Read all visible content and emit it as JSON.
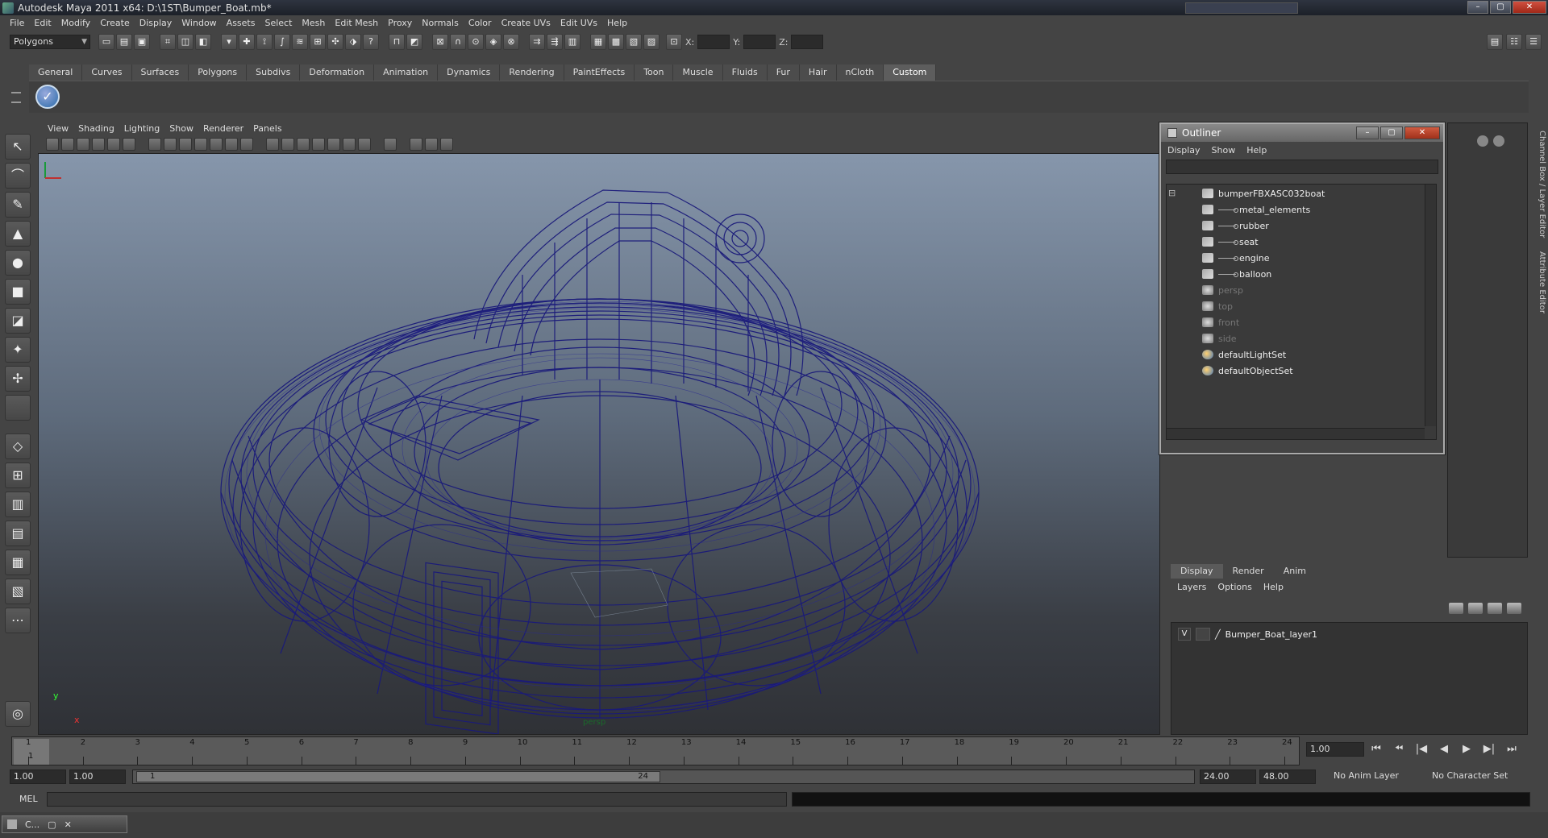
{
  "window": {
    "title": "Autodesk Maya 2011 x64: D:\\1ST\\Bumper_Boat.mb*",
    "min": "–",
    "max": "▢",
    "close": "✕"
  },
  "menubar": [
    "File",
    "Edit",
    "Modify",
    "Create",
    "Display",
    "Window",
    "Assets",
    "Select",
    "Mesh",
    "Edit Mesh",
    "Proxy",
    "Normals",
    "Color",
    "Create UVs",
    "Edit UVs",
    "Help"
  ],
  "statusline": {
    "mode": "Polygons",
    "x_label": "X:",
    "y_label": "Y:",
    "z_label": "Z:"
  },
  "shelf_tabs": [
    "General",
    "Curves",
    "Surfaces",
    "Polygons",
    "Subdivs",
    "Deformation",
    "Animation",
    "Dynamics",
    "Rendering",
    "PaintEffects",
    "Toon",
    "Muscle",
    "Fluids",
    "Fur",
    "Hair",
    "nCloth",
    "Custom"
  ],
  "shelf_active": "Custom",
  "viewport": {
    "menu": [
      "View",
      "Shading",
      "Lighting",
      "Show",
      "Renderer",
      "Panels"
    ],
    "camera": "persp",
    "axis_y": "y",
    "axis_x": "x"
  },
  "outliner": {
    "title": "Outliner",
    "menu": [
      "Display",
      "Show",
      "Help"
    ],
    "collapse": "⊟",
    "items": [
      {
        "label": "bumperFBXASC032boat",
        "style": "lit",
        "icon": "transform-icon",
        "indent": 0
      },
      {
        "label": "metal_elements",
        "style": "lit",
        "icon": "mesh-icon",
        "indent": 1
      },
      {
        "label": "rubber",
        "style": "lit",
        "icon": "mesh-icon",
        "indent": 1
      },
      {
        "label": "seat",
        "style": "lit",
        "icon": "mesh-icon",
        "indent": 1
      },
      {
        "label": "engine",
        "style": "lit",
        "icon": "mesh-icon",
        "indent": 1
      },
      {
        "label": "balloon",
        "style": "lit",
        "icon": "mesh-icon",
        "indent": 1
      },
      {
        "label": "persp",
        "style": "dim",
        "icon": "camera-icon",
        "indent": 0
      },
      {
        "label": "top",
        "style": "dim",
        "icon": "camera-icon",
        "indent": 0
      },
      {
        "label": "front",
        "style": "dim",
        "icon": "camera-icon",
        "indent": 0
      },
      {
        "label": "side",
        "style": "dim",
        "icon": "camera-icon",
        "indent": 0
      },
      {
        "label": "defaultLightSet",
        "style": "lit",
        "icon": "set-icon",
        "indent": 0
      },
      {
        "label": "defaultObjectSet",
        "style": "lit",
        "icon": "set-icon",
        "indent": 0
      }
    ]
  },
  "right_tabs": [
    "Channel Box / Layer Editor",
    "Attribute Editor"
  ],
  "layers": {
    "tabs": [
      "Display",
      "Render",
      "Anim"
    ],
    "menu": [
      "Layers",
      "Options",
      "Help"
    ],
    "layer_visible": "V",
    "layer_name": "Bumper_Boat_layer1"
  },
  "timeline": {
    "ticks": [
      "1",
      "2",
      "3",
      "4",
      "5",
      "6",
      "7",
      "8",
      "9",
      "10",
      "11",
      "12",
      "13",
      "14",
      "15",
      "16",
      "17",
      "18",
      "19",
      "20",
      "21",
      "22",
      "23",
      "24"
    ],
    "current_marker": "1",
    "current_frame": "1.00",
    "playback": [
      "⏮",
      "⏪︎",
      "|◀",
      "◀",
      "▶",
      "▶|",
      "⏭"
    ]
  },
  "range": {
    "start_time": "1.00",
    "playback_start": "1.00",
    "handle_start": "1",
    "handle_end": "24",
    "playback_end": "24.00",
    "end_time": "48.00",
    "anim_layer": "No Anim Layer",
    "character_set": "No Character Set"
  },
  "cmdline": {
    "label": "MEL"
  },
  "taskbar": {
    "label": "C..."
  },
  "colors": {
    "wireframe": "#1a1a7a",
    "accent": "#5a5a5a"
  }
}
